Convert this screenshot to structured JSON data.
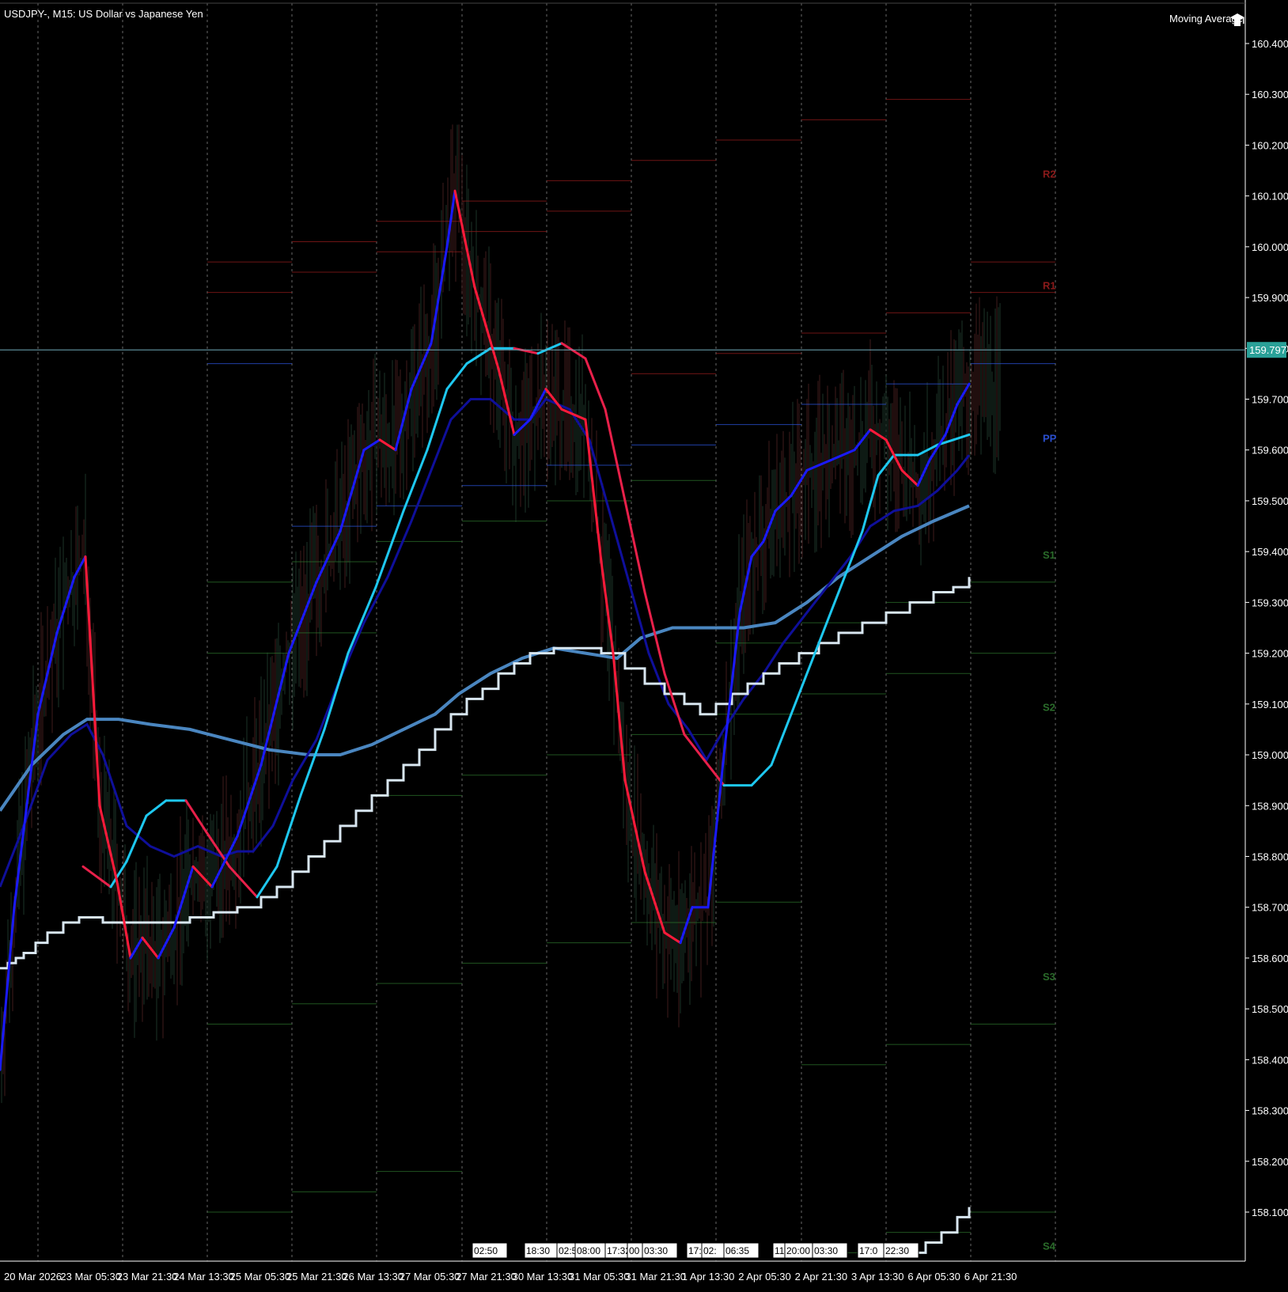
{
  "header": {
    "title": "USDJPY-, M15:  US Dollar vs Japanese Yen",
    "indicator": "Moving Average"
  },
  "colors": {
    "background": "#000000",
    "grid": "#c0c0c0",
    "axis": "#ffffff",
    "ma_fast_up": "#1a1aff",
    "ma_down": "#ff1a3a",
    "ma_cyan": "#1ec8f0",
    "ma_navy": "#0f0f9a",
    "ma_steel": "#4a86c0",
    "ma_white": "#d8e6f0",
    "current_price_bg": "#2aa198",
    "pivot_r": "#8a1a1a",
    "pivot_pp": "#2a4fd0",
    "pivot_s": "#2a6b2a"
  },
  "icons": {
    "indicator": "cap-icon"
  },
  "chart_data": {
    "type": "line",
    "title": "USDJPY-, M15:  US Dollar vs Japanese Yen",
    "ylim": [
      158.01,
      160.48
    ],
    "grid": true,
    "y_ticks": [
      "160.400",
      "160.300",
      "160.200",
      "160.100",
      "160.000",
      "159.900",
      "159.800",
      "159.700",
      "159.600",
      "159.500",
      "159.400",
      "159.300",
      "159.200",
      "159.100",
      "159.000",
      "158.900",
      "158.800",
      "158.700",
      "158.600",
      "158.500",
      "158.400",
      "158.300",
      "158.200",
      "158.100"
    ],
    "x_ticks": [
      "20 Mar 2026",
      "23 Mar 05:30",
      "23 Mar 21:30",
      "24 Mar 13:30",
      "25 Mar 05:30",
      "25 Mar 21:30",
      "26 Mar 13:30",
      "27 Mar 05:30",
      "27 Mar 21:30",
      "30 Mar 13:30",
      "31 Mar 05:30",
      "31 Mar 21:30",
      "1 Apr 13:30",
      "2 Apr 05:30",
      "2 Apr 21:30",
      "3 Apr 13:30",
      "6 Apr 05:30",
      "6 Apr 21:30"
    ],
    "session_labels": [
      "02:50",
      "18:30",
      "02:5",
      "08:00",
      "17:32",
      "00",
      "03:30",
      "17:30",
      "02:",
      "06:35",
      "11",
      "20:00",
      "03:30",
      "17:0",
      "22:30"
    ],
    "current_price": "159.797",
    "pivot_labels": [
      "R2",
      "R1",
      "PP",
      "S1",
      "S2",
      "S3",
      "S4"
    ],
    "pivots": [
      {
        "label": "R2",
        "value": 160.13
      },
      {
        "label": "R1",
        "value": 159.91
      },
      {
        "label": "PP",
        "value": 159.61
      },
      {
        "label": "S1",
        "value": 159.38
      },
      {
        "label": "S2",
        "value": 159.08
      },
      {
        "label": "S3",
        "value": 158.55
      },
      {
        "label": "S4",
        "value": 158.02
      }
    ],
    "series": [
      {
        "key": "ma_fast",
        "points": [
          [
            0,
            158.38
          ],
          [
            18,
            158.7
          ],
          [
            48,
            159.08
          ],
          [
            72,
            159.24
          ],
          [
            94,
            159.35
          ],
          [
            108,
            159.39
          ],
          [
            126,
            158.9
          ],
          [
            148,
            158.75
          ],
          [
            165,
            158.6
          ],
          [
            180,
            158.64
          ],
          [
            200,
            158.6
          ],
          [
            220,
            158.66
          ],
          [
            244,
            158.78
          ],
          [
            268,
            158.74
          ],
          [
            300,
            158.84
          ],
          [
            330,
            158.98
          ],
          [
            365,
            159.2
          ],
          [
            400,
            159.34
          ],
          [
            430,
            159.44
          ],
          [
            460,
            159.6
          ],
          [
            480,
            159.62
          ],
          [
            500,
            159.6
          ],
          [
            520,
            159.72
          ],
          [
            545,
            159.81
          ],
          [
            565,
            160.0
          ],
          [
            575,
            160.11
          ],
          [
            600,
            159.92
          ],
          [
            630,
            159.76
          ],
          [
            650,
            159.63
          ],
          [
            670,
            159.66
          ],
          [
            690,
            159.72
          ],
          [
            710,
            159.68
          ],
          [
            740,
            159.66
          ],
          [
            760,
            159.38
          ],
          [
            775,
            159.2
          ],
          [
            790,
            158.95
          ],
          [
            815,
            158.77
          ],
          [
            840,
            158.65
          ],
          [
            860,
            158.63
          ],
          [
            875,
            158.7
          ],
          [
            895,
            158.7
          ],
          [
            915,
            159.0
          ],
          [
            935,
            159.28
          ],
          [
            950,
            159.39
          ],
          [
            965,
            159.42
          ],
          [
            980,
            159.48
          ],
          [
            1000,
            159.51
          ],
          [
            1020,
            159.56
          ],
          [
            1050,
            159.58
          ],
          [
            1080,
            159.6
          ],
          [
            1100,
            159.64
          ],
          [
            1120,
            159.62
          ],
          [
            1140,
            159.56
          ],
          [
            1160,
            159.53
          ],
          [
            1175,
            159.58
          ],
          [
            1195,
            159.63
          ],
          [
            1210,
            159.69
          ],
          [
            1225,
            159.73
          ]
        ]
      },
      {
        "key": "ma_cyan",
        "points": [
          [
            105,
            158.78
          ],
          [
            140,
            158.74
          ],
          [
            160,
            158.79
          ],
          [
            185,
            158.88
          ],
          [
            210,
            158.91
          ],
          [
            235,
            158.91
          ],
          [
            260,
            158.85
          ],
          [
            290,
            158.78
          ],
          [
            325,
            158.72
          ],
          [
            350,
            158.78
          ],
          [
            380,
            158.92
          ],
          [
            410,
            159.05
          ],
          [
            440,
            159.2
          ],
          [
            475,
            159.33
          ],
          [
            510,
            159.48
          ],
          [
            540,
            159.6
          ],
          [
            565,
            159.72
          ],
          [
            590,
            159.77
          ],
          [
            620,
            159.8
          ],
          [
            650,
            159.8
          ],
          [
            680,
            159.79
          ],
          [
            710,
            159.81
          ],
          [
            740,
            159.78
          ],
          [
            765,
            159.68
          ],
          [
            790,
            159.5
          ],
          [
            815,
            159.32
          ],
          [
            840,
            159.16
          ],
          [
            865,
            159.04
          ],
          [
            890,
            158.99
          ],
          [
            915,
            158.94
          ],
          [
            950,
            158.94
          ],
          [
            975,
            158.98
          ],
          [
            1000,
            159.08
          ],
          [
            1030,
            159.2
          ],
          [
            1060,
            159.32
          ],
          [
            1090,
            159.44
          ],
          [
            1110,
            159.55
          ],
          [
            1130,
            159.59
          ],
          [
            1160,
            159.59
          ],
          [
            1185,
            159.61
          ],
          [
            1205,
            159.62
          ],
          [
            1225,
            159.63
          ]
        ]
      },
      {
        "key": "ma_navy",
        "points": [
          [
            0,
            158.74
          ],
          [
            30,
            158.86
          ],
          [
            60,
            158.99
          ],
          [
            90,
            159.04
          ],
          [
            110,
            159.06
          ],
          [
            130,
            159.0
          ],
          [
            160,
            158.86
          ],
          [
            190,
            158.82
          ],
          [
            220,
            158.8
          ],
          [
            250,
            158.82
          ],
          [
            280,
            158.8
          ],
          [
            300,
            158.81
          ],
          [
            320,
            158.81
          ],
          [
            345,
            158.86
          ],
          [
            370,
            158.95
          ],
          [
            400,
            159.03
          ],
          [
            430,
            159.15
          ],
          [
            460,
            159.26
          ],
          [
            490,
            159.35
          ],
          [
            520,
            159.46
          ],
          [
            545,
            159.56
          ],
          [
            570,
            159.66
          ],
          [
            595,
            159.7
          ],
          [
            620,
            159.7
          ],
          [
            650,
            159.66
          ],
          [
            670,
            159.66
          ],
          [
            690,
            159.7
          ],
          [
            720,
            159.68
          ],
          [
            745,
            159.62
          ],
          [
            770,
            159.48
          ],
          [
            795,
            159.34
          ],
          [
            820,
            159.2
          ],
          [
            845,
            159.1
          ],
          [
            870,
            159.05
          ],
          [
            893,
            158.99
          ],
          [
            915,
            159.05
          ],
          [
            940,
            159.11
          ],
          [
            965,
            159.16
          ],
          [
            990,
            159.22
          ],
          [
            1020,
            159.28
          ],
          [
            1050,
            159.34
          ],
          [
            1075,
            159.39
          ],
          [
            1100,
            159.45
          ],
          [
            1130,
            159.48
          ],
          [
            1160,
            159.49
          ],
          [
            1185,
            159.52
          ],
          [
            1210,
            159.56
          ],
          [
            1225,
            159.59
          ]
        ]
      },
      {
        "key": "ma_steel",
        "points": [
          [
            0,
            158.89
          ],
          [
            40,
            158.98
          ],
          [
            80,
            159.04
          ],
          [
            110,
            159.07
          ],
          [
            150,
            159.07
          ],
          [
            190,
            159.06
          ],
          [
            240,
            159.05
          ],
          [
            290,
            159.03
          ],
          [
            340,
            159.01
          ],
          [
            390,
            159.0
          ],
          [
            430,
            159.0
          ],
          [
            470,
            159.02
          ],
          [
            510,
            159.05
          ],
          [
            550,
            159.08
          ],
          [
            580,
            159.12
          ],
          [
            620,
            159.16
          ],
          [
            660,
            159.19
          ],
          [
            700,
            159.21
          ],
          [
            740,
            159.2
          ],
          [
            780,
            159.19
          ],
          [
            810,
            159.23
          ],
          [
            850,
            159.25
          ],
          [
            900,
            159.25
          ],
          [
            940,
            159.25
          ],
          [
            980,
            159.26
          ],
          [
            1020,
            159.3
          ],
          [
            1060,
            159.35
          ],
          [
            1100,
            159.39
          ],
          [
            1140,
            159.43
          ],
          [
            1180,
            159.46
          ],
          [
            1225,
            159.49
          ]
        ]
      },
      {
        "key": "ma_white",
        "points": [
          [
            0,
            158.58
          ],
          [
            10,
            158.59
          ],
          [
            20,
            158.6
          ],
          [
            30,
            158.61
          ],
          [
            45,
            158.63
          ],
          [
            60,
            158.65
          ],
          [
            80,
            158.67
          ],
          [
            100,
            158.68
          ],
          [
            130,
            158.67
          ],
          [
            170,
            158.67
          ],
          [
            210,
            158.67
          ],
          [
            240,
            158.68
          ],
          [
            270,
            158.69
          ],
          [
            300,
            158.7
          ],
          [
            330,
            158.72
          ],
          [
            350,
            158.74
          ],
          [
            370,
            158.77
          ],
          [
            390,
            158.8
          ],
          [
            410,
            158.83
          ],
          [
            430,
            158.86
          ],
          [
            450,
            158.89
          ],
          [
            470,
            158.92
          ],
          [
            490,
            158.95
          ],
          [
            510,
            158.98
          ],
          [
            530,
            159.01
          ],
          [
            550,
            159.05
          ],
          [
            570,
            159.08
          ],
          [
            590,
            159.11
          ],
          [
            610,
            159.13
          ],
          [
            630,
            159.16
          ],
          [
            650,
            159.18
          ],
          [
            670,
            159.2
          ],
          [
            700,
            159.21
          ],
          [
            730,
            159.21
          ],
          [
            760,
            159.2
          ],
          [
            790,
            159.17
          ],
          [
            815,
            159.14
          ],
          [
            840,
            159.12
          ],
          [
            865,
            159.1
          ],
          [
            885,
            159.08
          ],
          [
            905,
            159.1
          ],
          [
            925,
            159.12
          ],
          [
            945,
            159.14
          ],
          [
            965,
            159.16
          ],
          [
            985,
            159.18
          ],
          [
            1010,
            159.2
          ],
          [
            1035,
            159.22
          ],
          [
            1060,
            159.24
          ],
          [
            1090,
            159.26
          ],
          [
            1120,
            159.28
          ],
          [
            1150,
            159.3
          ],
          [
            1180,
            159.32
          ],
          [
            1205,
            159.33
          ],
          [
            1225,
            159.35
          ]
        ]
      },
      {
        "key": "ma_white_future",
        "points": [
          [
            1150,
            158.02
          ],
          [
            1170,
            158.04
          ],
          [
            1190,
            158.06
          ],
          [
            1210,
            158.09
          ],
          [
            1225,
            158.11
          ]
        ]
      }
    ]
  }
}
